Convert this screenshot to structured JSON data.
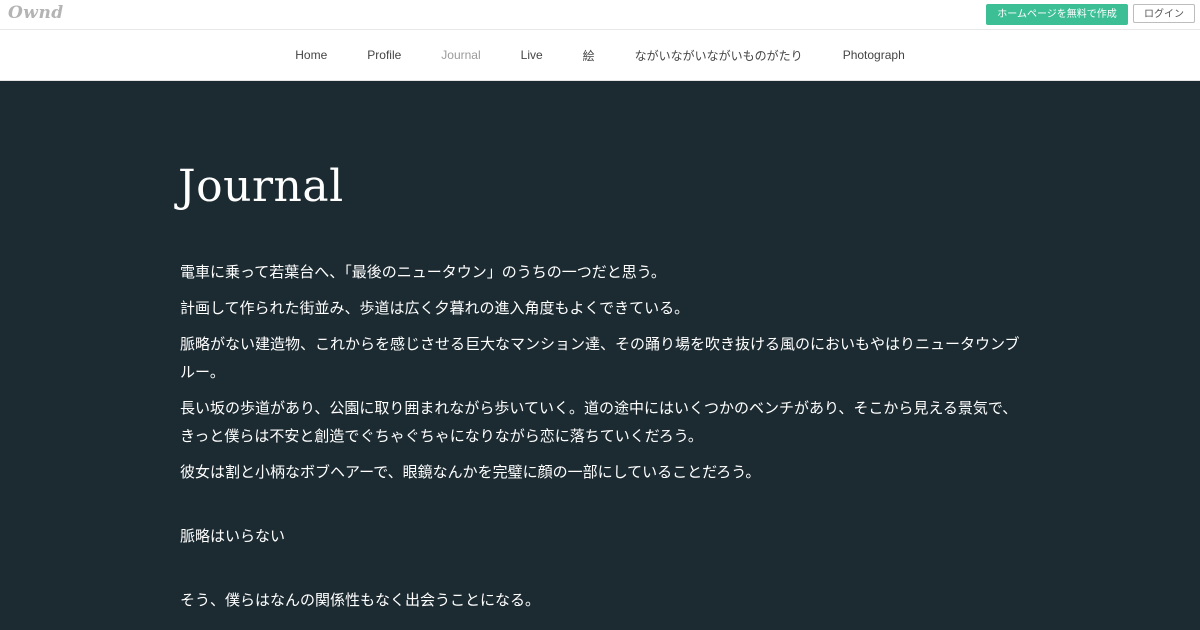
{
  "topbar": {
    "logo": "Ownd",
    "create_button": "ホームページを無料で作成",
    "login_button": "ログイン"
  },
  "nav": {
    "items": [
      {
        "label": "Home",
        "active": false
      },
      {
        "label": "Profile",
        "active": false
      },
      {
        "label": "Journal",
        "active": true
      },
      {
        "label": "Live",
        "active": false
      },
      {
        "label": "絵",
        "active": false
      },
      {
        "label": "ながいながいながいものがたり",
        "active": false
      },
      {
        "label": "Photograph",
        "active": false
      }
    ]
  },
  "main": {
    "title": "Journal",
    "paragraphs": [
      "電車に乗って若葉台へ、「最後のニュータウン」のうちの一つだと思う。",
      "計画して作られた街並み、歩道は広く夕暮れの進入角度もよくできている。",
      "脈略がない建造物、これからを感じさせる巨大なマンション達、その踊り場を吹き抜ける風のにおいもやはりニュータウンブルー。",
      "長い坂の歩道があり、公園に取り囲まれながら歩いていく。道の途中にはいくつかのベンチがあり、そこから見える景気で、きっと僕らは不安と創造でぐちゃぐちゃになりながら恋に落ちていくだろう。",
      "彼女は割と小柄なボブヘアーで、眼鏡なんかを完璧に顔の一部にしていることだろう。",
      "脈略はいらない",
      "そう、僕らはなんの関係性もなく出会うことになる。"
    ]
  },
  "colors": {
    "accent": "#3dbf95",
    "content_background": "#1c2b32",
    "active_nav": "#9a9a9a"
  }
}
